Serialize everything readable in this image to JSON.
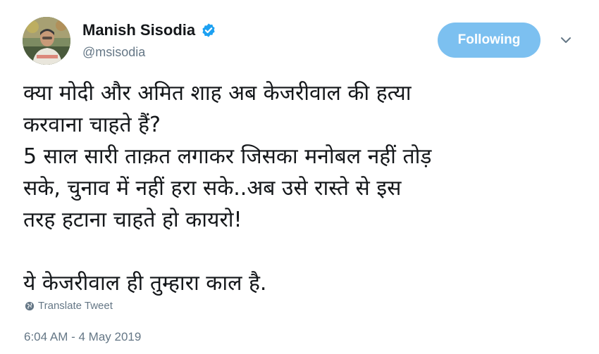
{
  "author": {
    "display_name": "Manish Sisodia",
    "handle": "@msisodia",
    "verified": true
  },
  "follow_button": {
    "label": "Following",
    "color": "#7cc0f0"
  },
  "tweet": {
    "lines": [
      "क्या मोदी और अमित शाह अब केजरीवाल की हत्या",
      "करवाना चाहते हैं?",
      "5 साल सारी ताक़त लगाकर जिसका मनोबल नहीं तोड़",
      "सके, चुनाव में नहीं हरा सके..अब उसे रास्ते से इस",
      "तरह हटाना चाहते हो कायरो!",
      "",
      "ये केजरीवाल ही तुम्हारा काल है."
    ]
  },
  "translate": {
    "label": "Translate Tweet",
    "icon": "globe-icon"
  },
  "timestamp": "6:04 AM - 4 May 2019",
  "colors": {
    "verified_badge": "#1da1f2",
    "secondary_text": "#657786",
    "primary_text": "#14171a"
  },
  "icons": {
    "verified": "verified-badge-icon",
    "more": "chevron-down-icon"
  }
}
